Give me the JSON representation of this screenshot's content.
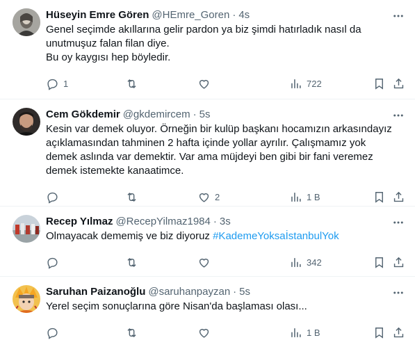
{
  "tweets": [
    {
      "name": "Hüseyin Emre Gören",
      "handle": "@HEmre_Goren",
      "dot": "·",
      "time": "4s",
      "text": "Genel seçimde akıllarına gelir pardon ya biz şimdi hatırladık nasıl da\nunutmuşuz falan filan diye.\nBu oy kaygısı hep böyledir.",
      "reply_count": "1",
      "retweet_count": "",
      "like_count": "",
      "view_count": "722"
    },
    {
      "name": "Cem Gökdemir",
      "handle": "@gkdemircem",
      "dot": "·",
      "time": "5s",
      "text": "Kesin var demek oluyor. Örneğin bir kulüp başkanı hocamızın arkasındayız\naçıklamasından tahminen 2 hafta içinde yollar ayrılır. Çalışmamız yok\ndemek aslında var demektir. Var ama müjdeyi ben gibi bir fani veremez\ndemek istemekte kanaatimce.",
      "reply_count": "",
      "retweet_count": "",
      "like_count": "2",
      "view_count": "1 B"
    },
    {
      "name": "Recep Yılmaz",
      "handle": "@RecepYilmaz1984",
      "dot": "·",
      "time": "3s",
      "text": "Olmayacak dememiş ve biz diyoruz ",
      "hashtag": "#KademeYoksaİstanbulYok",
      "reply_count": "",
      "retweet_count": "",
      "like_count": "",
      "view_count": "342"
    },
    {
      "name": "Saruhan Paizanoğlu",
      "handle": "@saruhanpayzan",
      "dot": "·",
      "time": "5s",
      "text": "Yerel seçim sonuçlarına göre Nisan'da başlaması olası...",
      "reply_count": "",
      "retweet_count": "",
      "like_count": "",
      "view_count": "1 B"
    }
  ],
  "icons": {
    "more": "more-horizontal-icon",
    "reply": "reply-bubble-icon",
    "retweet": "retweet-icon",
    "like": "heart-icon",
    "views": "views-bar-chart-icon",
    "bookmark": "bookmark-icon",
    "share": "share-upload-icon"
  },
  "colors": {
    "text": "#0f1419",
    "secondary": "#536471",
    "link": "#1d9bf0",
    "divider": "#eff3f4"
  }
}
